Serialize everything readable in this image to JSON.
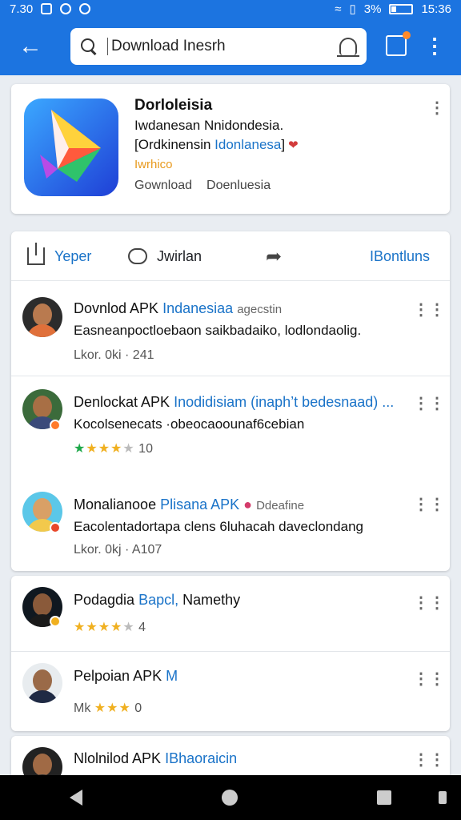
{
  "status_bar": {
    "time_left": "7.30",
    "battery": "3%",
    "time_right": "15:36"
  },
  "topbar": {
    "search_value": "Download Inesrh"
  },
  "app_card": {
    "title": "Dorloleisia",
    "line1": "Iwdanesan Nnidondesia.",
    "line2_prefix": "[Ordkinensin",
    "line2_link": "Idonlanesa",
    "line2_suffix": "]",
    "tag": "Iwrhico",
    "meta_left": "Gownload",
    "meta_right": "Doenluesia"
  },
  "actions": {
    "a1": "Yeper",
    "a2": "Jwirlan",
    "a3": "IBontluns"
  },
  "feed": [
    {
      "title_prefix": "Dovnlod APK",
      "title_link": "Indanesiaa",
      "title_extra": "agecstin",
      "desc": "Easneanpoctloebaon saikbadaiko, lodlondaolig.",
      "meta": "Lkor. 0ki · 241"
    },
    {
      "title_prefix": "Denlockat APK",
      "title_link": "Inodidisiam (inaph’t bedesnaad) ...",
      "desc": "Kocolsenecats ·obeocaoounaf6cebian",
      "stars_rating": "4",
      "stars_count": "10"
    },
    {
      "title_prefix": "Monalianooe",
      "title_link": "Plisana APK",
      "title_extra": "Ddeafine",
      "desc": "Eacolentadortapa clens 6luhacah daveclondang",
      "meta": "Lkor. 0kj · A107"
    },
    {
      "title_prefix": "Podagdia",
      "title_link": "Bapcl,",
      "title_suffix": "Namethy",
      "stars_count": "4"
    },
    {
      "title_prefix": "Pelpoian APK",
      "title_link": "M",
      "meta_prefix": "Mk",
      "stars_count": "0"
    },
    {
      "title_prefix": "Nlolnilod APK",
      "title_link": "IBhaoraicin"
    }
  ],
  "icons": [
    "back-arrow-icon",
    "search-icon",
    "mic-icon",
    "edit-icon",
    "more-icon",
    "share-icon",
    "comment-icon",
    "forward-icon"
  ]
}
